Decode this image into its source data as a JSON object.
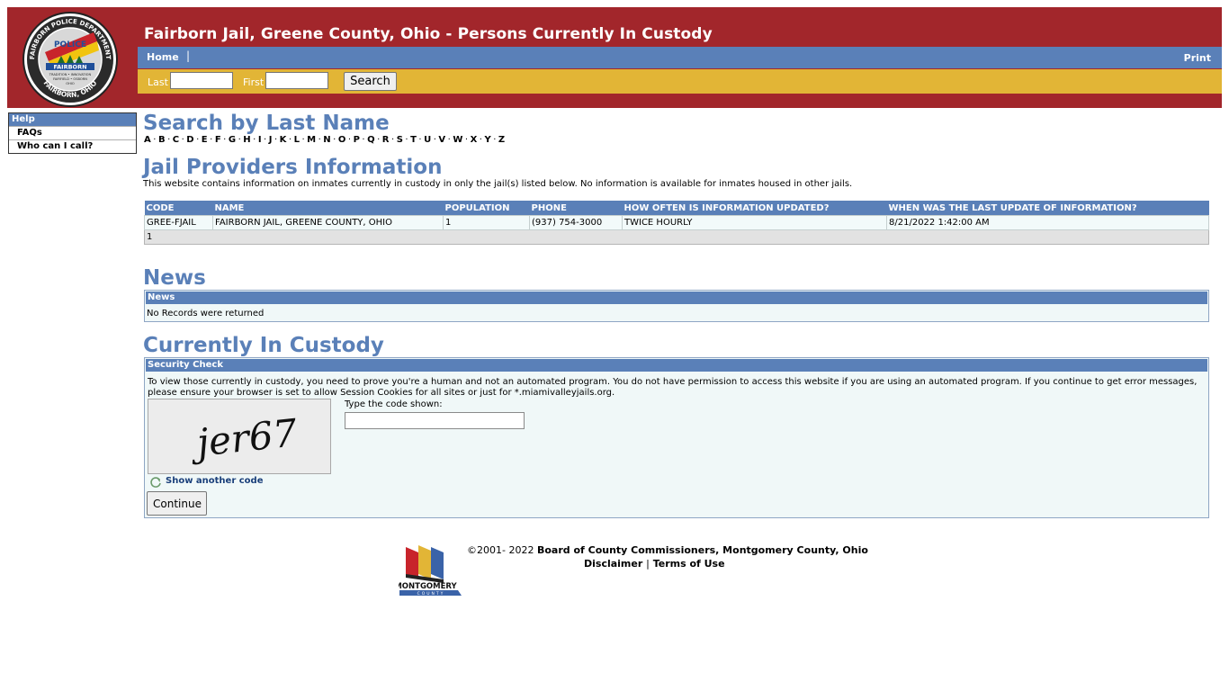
{
  "header": {
    "title": "Fairborn Jail, Greene County, Ohio - Persons Currently In Custody",
    "badge": {
      "top_text": "FAIRBORN POLICE DEPARTMENT",
      "ring_bottom": "FAIRBORN, OHIO",
      "center": "POLICE",
      "banner": "FAIRBORN",
      "est": "EST. 1950",
      "motto1": "TRADITION • INNOVATION",
      "motto2": "FAIRFIELD • OSBORN",
      "motto3": "OHIO"
    }
  },
  "nav": {
    "home": "Home",
    "separator": "|",
    "print": "Print"
  },
  "search": {
    "last_label": "Last",
    "first_label": "First",
    "last_value": "",
    "first_value": "",
    "button": "Search"
  },
  "leftmenu": {
    "header": "Help",
    "items": [
      "FAQs",
      "Who can I call?"
    ]
  },
  "last_name_section": {
    "title": "Search by Last Name",
    "letters": [
      "A",
      "B",
      "C",
      "D",
      "E",
      "F",
      "G",
      "H",
      "I",
      "J",
      "K",
      "L",
      "M",
      "N",
      "O",
      "P",
      "Q",
      "R",
      "S",
      "T",
      "U",
      "V",
      "W",
      "X",
      "Y",
      "Z"
    ]
  },
  "providers": {
    "title": "Jail Providers Information",
    "note": "This website contains information on inmates currently in custody in only the jail(s) listed below. No information is available for inmates housed in other jails.",
    "columns": [
      "CODE",
      "NAME",
      "POPULATION",
      "PHONE",
      "HOW OFTEN IS INFORMATION UPDATED?",
      "WHEN WAS THE LAST UPDATE OF INFORMATION?"
    ],
    "rows": [
      [
        "GREE-FJAIL",
        "FAIRBORN JAIL, GREENE COUNTY, OHIO",
        "1",
        "(937) 754-3000",
        "TWICE HOURLY",
        "8/21/2022 1:42:00 AM"
      ]
    ],
    "pager": "1"
  },
  "news": {
    "title": "News",
    "header": "News",
    "empty": "No Records were returned"
  },
  "custody": {
    "title": "Currently In Custody",
    "header": "Security Check",
    "message": "To view those currently in custody, you need to prove you're a human and not an automated program. You do not have permission to access this website if you are using an automated program. If you continue to get error messages, please ensure your browser is set to allow Session Cookies for all sites or just for *.miamivalleyjails.org.",
    "captcha_text": "jer67",
    "code_label": "Type the code shown:",
    "code_value": "",
    "another_code": "Show another code",
    "continue": "Continue"
  },
  "footer": {
    "copyright_prefix": "©2001- 2022 ",
    "copyright_org": "Board of County Commissioners, Montgomery County, Ohio",
    "disclaimer": "Disclaimer",
    "sep": "|",
    "terms": "Terms of Use",
    "logo_text": "MONTGOMERY",
    "logo_sub": "COUNTY"
  },
  "colors": {
    "header_red": "#a2262b",
    "nav_blue": "#5a80b8",
    "search_gold": "#e2b536"
  }
}
